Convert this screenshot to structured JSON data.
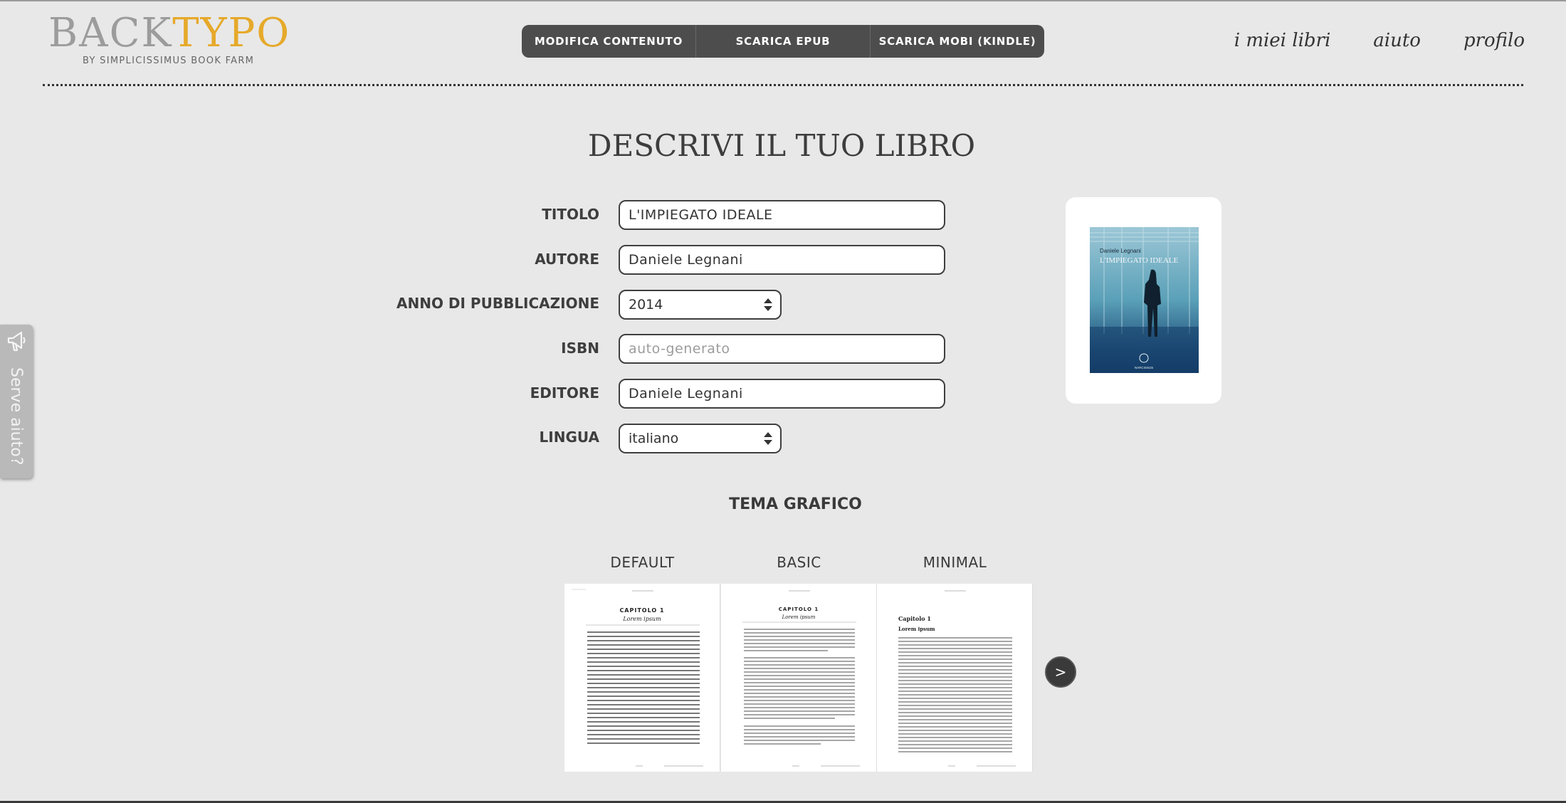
{
  "logo": {
    "word_back": "BACK",
    "word_typo": "TYPO",
    "subtitle": "BY SIMPLICISSIMUS BOOK FARM"
  },
  "toolbar": {
    "edit_label": "MODIFICA CONTENUTO",
    "epub_label": "SCARICA EPUB",
    "mobi_label": "SCARICA MOBI (KINDLE)"
  },
  "nav": {
    "books": "i miei libri",
    "help": "aiuto",
    "profile": "profilo"
  },
  "help_tab": {
    "label": "Serve aiuto?",
    "icon": "megaphone-icon"
  },
  "page_title": "DESCRIVI IL TUO LIBRO",
  "form": {
    "title_label": "TITOLO",
    "title_value": "L'IMPIEGATO IDEALE",
    "author_label": "AUTORE",
    "author_value": "Daniele Legnani",
    "year_label": "ANNO DI PUBBLICAZIONE",
    "year_value": "2014",
    "isbn_label": "ISBN",
    "isbn_value": "",
    "isbn_placeholder": "auto-generato",
    "publisher_label": "EDITORE",
    "publisher_value": "Daniele Legnani",
    "language_label": "LINGUA",
    "language_value": "italiano"
  },
  "cover": {
    "author": "Daniele Legnani",
    "title": "L'IMPIEGATO IDEALE",
    "publisher": "NARCISSUS"
  },
  "themes": {
    "heading": "TEMA GRAFICO",
    "items": [
      {
        "name": "DEFAULT",
        "chapter": "CAPITOLO 1",
        "subtitle": "Lorem ipsum"
      },
      {
        "name": "BASIC",
        "chapter": "CAPITOLO 1",
        "subtitle": "Lorem ipsum"
      },
      {
        "name": "MINIMAL",
        "chapter": "Capitolo 1",
        "subtitle": "Lorem ipsum"
      }
    ],
    "next_label": ">"
  },
  "colors": {
    "background": "#e8e8e8",
    "accent": "#e6a92a",
    "toolbar": "#4d4d4d",
    "text": "#3c3c3c"
  }
}
